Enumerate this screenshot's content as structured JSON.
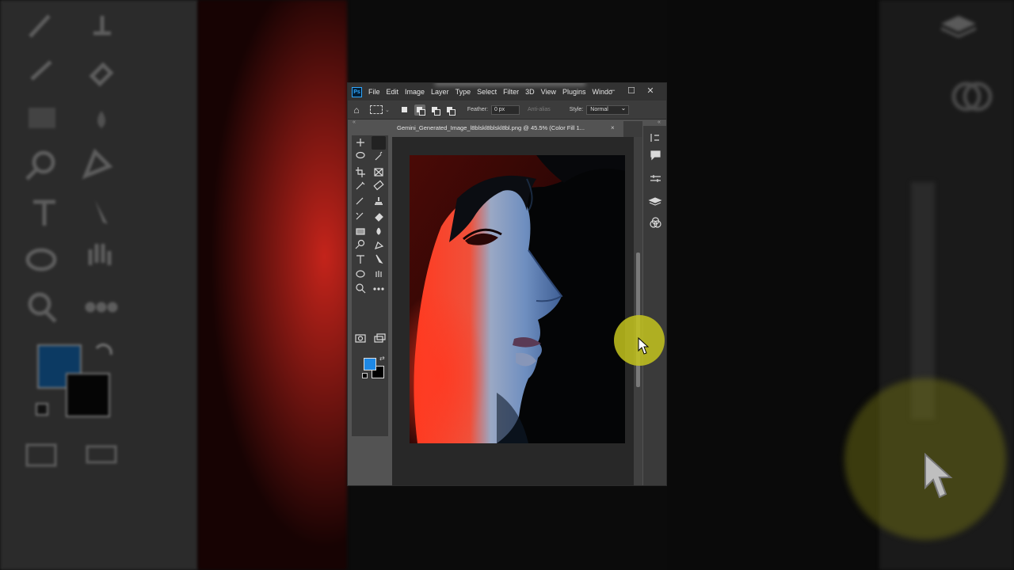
{
  "app": {
    "logo_text": "Ps",
    "menus": [
      "File",
      "Edit",
      "Image",
      "Layer",
      "Type",
      "Select",
      "Filter",
      "3D",
      "View",
      "Plugins",
      "Windo"
    ]
  },
  "window_controls": {
    "minimize": "–",
    "maximize": "☐",
    "close": "✕"
  },
  "options": {
    "feather_label": "Feather:",
    "feather_value": "0 px",
    "antialias_label": "Anti-alias",
    "style_label": "Style:",
    "style_value": "Normal"
  },
  "document": {
    "tab_title": "Gemini_Generated_Image_l8blskl8blskl8bl.png @ 45.5% (Color Fill 1...",
    "close": "×"
  },
  "collapse": {
    "left": "«",
    "right": "«"
  },
  "colors": {
    "foreground": "#1e88e5",
    "background": "#000000",
    "highlight": "#c4c41e"
  },
  "tools": [
    "move-tool",
    "rectangular-marquee-tool",
    "lasso-tool",
    "quick-selection-tool",
    "crop-tool",
    "frame-tool",
    "eyedropper-tool",
    "spot-healing-brush-tool",
    "brush-tool",
    "clone-stamp-tool",
    "history-brush-tool",
    "eraser-tool",
    "gradient-tool",
    "blur-tool",
    "dodge-tool",
    "pen-tool",
    "type-tool",
    "path-selection-tool",
    "ellipse-tool",
    "hand-tool",
    "zoom-tool",
    "edit-toolbar",
    "quick-mask-mode",
    "screen-mode"
  ],
  "right_panel": [
    "history-icon",
    "comments-icon",
    "adjustments-icon",
    "layers-icon",
    "channels-icon"
  ]
}
